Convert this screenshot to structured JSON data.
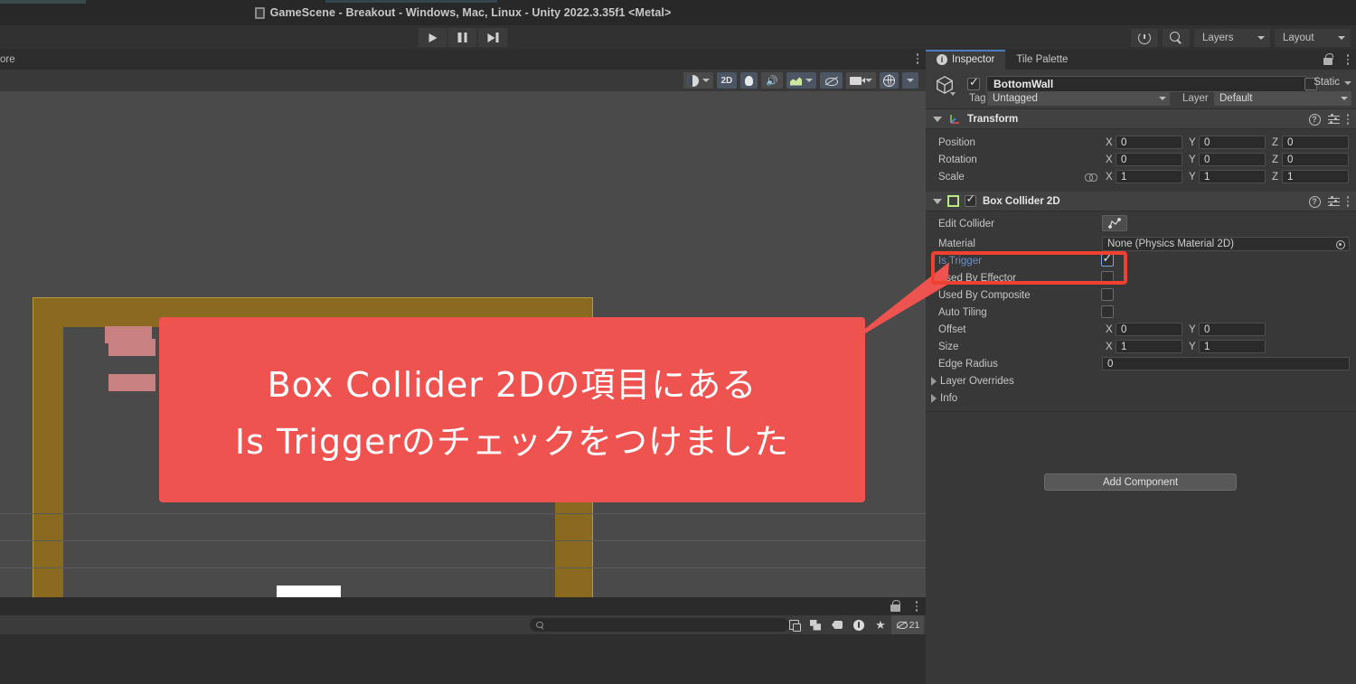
{
  "window": {
    "title": "GameScene - Breakout - Windows, Mac, Linux - Unity 2022.3.35f1 <Metal>",
    "doc_icon": "scene-file-icon"
  },
  "playbar": {
    "play_label": "play-icon",
    "pause_label": "pause-icon",
    "step_label": "step-icon"
  },
  "toolbar": {
    "history_icon": "history-icon",
    "search_icon": "search-icon",
    "layers_label": "Layers",
    "layout_label": "Layout"
  },
  "scene_panel": {
    "tab_label": "ore",
    "toolbar": {
      "shading_icon": "shading-mode-icon",
      "mode_2d": "2D",
      "lighting_icon": "lighting-icon",
      "audio_icon": "audio-icon",
      "effects_icon": "effects-icon",
      "hidden_icon": "visibility-toggle-icon",
      "camera_icon": "scene-camera-icon",
      "gizmos_icon": "gizmos-icon"
    },
    "scene": {
      "wall_color": "#8a6a1e",
      "field_color": "#4a4a4a",
      "brick_color": "#c88080",
      "paddle_color": "#ffffff",
      "gizmo_arrow_color": "#9ae84e",
      "brick_rows": [
        [
          120,
          274
        ],
        [
          120,
          313
        ],
        [
          116,
          360
        ]
      ],
      "brick_cols": [
        120,
        186,
        252,
        318,
        384,
        450,
        516
      ],
      "brick_count_row3": 1
    }
  },
  "project_panel": {
    "search_placeholder": "",
    "icons": [
      "stack-icon",
      "drag-drop-icon",
      "tag-icon",
      "warning-icon",
      "favorite-star-icon",
      "hidden-objects-icon"
    ],
    "hidden_count": "21"
  },
  "inspector": {
    "tabs": [
      {
        "label": "Inspector",
        "icon": "info-icon",
        "active": true
      },
      {
        "label": "Tile Palette",
        "icon": "",
        "active": false
      }
    ],
    "lock_icon": "lock-icon",
    "menu_icon": "kebab-menu-icon",
    "gameobject": {
      "icon": "cube-icon",
      "enabled": true,
      "name": "BottomWall",
      "static_label": "Static",
      "static_checked": false,
      "tag_label": "Tag",
      "tag_value": "Untagged",
      "layer_label": "Layer",
      "layer_value": "Default"
    },
    "components": [
      {
        "title": "Transform",
        "icon": "transform-icon",
        "expanded": true,
        "rows": [
          {
            "label": "Position",
            "axes": [
              "X",
              "Y",
              "Z"
            ],
            "values": [
              "0",
              "0",
              "0"
            ]
          },
          {
            "label": "Rotation",
            "axes": [
              "X",
              "Y",
              "Z"
            ],
            "values": [
              "0",
              "0",
              "0"
            ]
          },
          {
            "label": "Scale",
            "axes": [
              "X",
              "Y",
              "Z"
            ],
            "values": [
              "1",
              "1",
              "1"
            ],
            "link_icon": "constrain-proportions-icon"
          }
        ]
      },
      {
        "title": "Box Collider 2D",
        "icon": "box-collider-2d-icon",
        "enabled": true,
        "expanded": true,
        "edit_collider_label": "Edit Collider",
        "edit_collider_icon": "edit-collider-icon",
        "material_label": "Material",
        "material_value": "None (Physics Material 2D)",
        "is_trigger_label": "Is Trigger",
        "is_trigger_checked": true,
        "used_by_effector_label": "Used By Effector",
        "used_by_effector_checked": false,
        "used_by_composite_label": "Used By Composite",
        "used_by_composite_checked": false,
        "auto_tiling_label": "Auto Tiling",
        "auto_tiling_checked": false,
        "offset_label": "Offset",
        "offset_values": [
          "0",
          "0"
        ],
        "size_label": "Size",
        "size_values": [
          "1",
          "1"
        ],
        "edge_radius_label": "Edge Radius",
        "edge_radius_value": "0",
        "layer_overrides_label": "Layer Overrides",
        "info_label": "Info"
      }
    ],
    "add_component_label": "Add Component"
  },
  "annotation": {
    "accent_color": "#ef5350",
    "highlight_border_color": "#f04030",
    "line1": "Box Collider 2Dの項目にある",
    "line2": "Is Triggerのチェックをつけました"
  }
}
